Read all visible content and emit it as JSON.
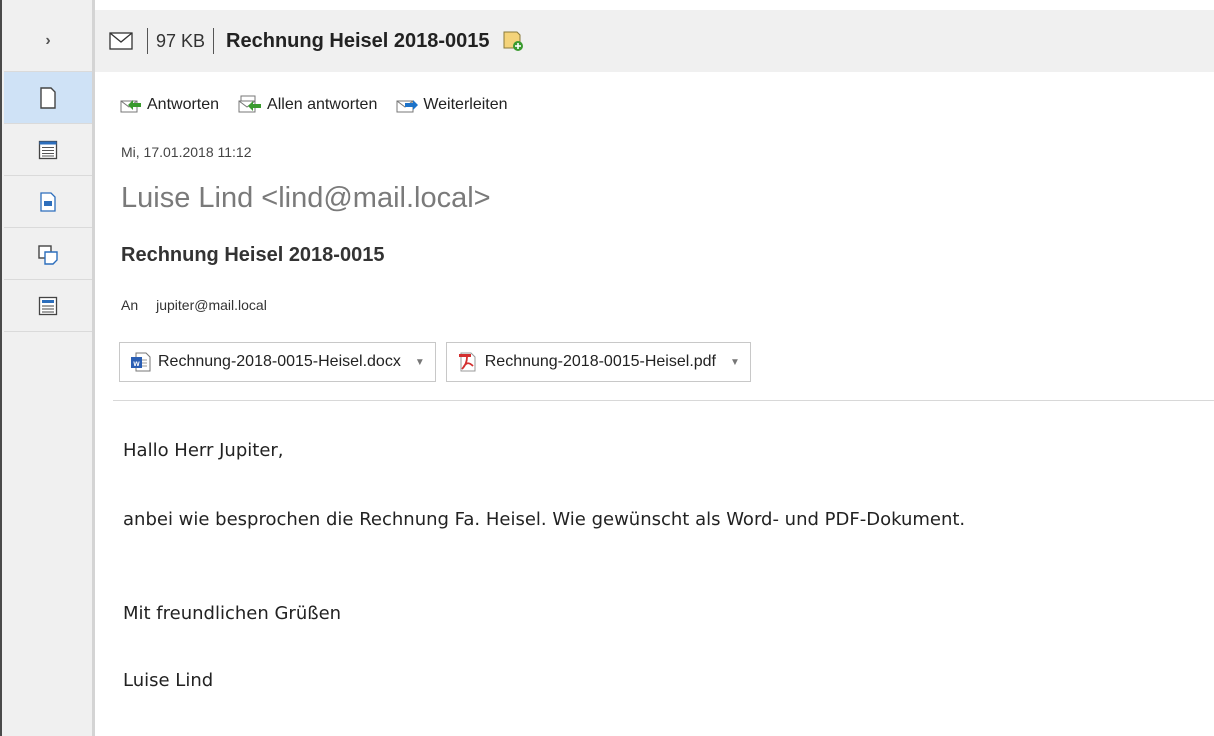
{
  "header": {
    "size": "97 KB",
    "subject": "Rechnung Heisel 2018-0015"
  },
  "rail": {
    "items": [
      "expand",
      "message-view",
      "table-view",
      "text-view",
      "notes-view",
      "details-view"
    ]
  },
  "actions": {
    "reply": "Antworten",
    "reply_all": "Allen antworten",
    "forward": "Weiterleiten"
  },
  "message": {
    "date": "Mi, 17.01.2018 11:12",
    "sender": "Luise Lind <lind@mail.local>",
    "subject": "Rechnung Heisel 2018-0015",
    "to_label": "An",
    "to": "jupiter@mail.local"
  },
  "attachments": [
    {
      "name": "Rechnung-2018-0015-Heisel.docx",
      "icon": "word-icon"
    },
    {
      "name": "Rechnung-2018-0015-Heisel.pdf",
      "icon": "pdf-icon"
    }
  ],
  "body": {
    "greeting": "Hallo Herr Jupiter,",
    "line1": "anbei wie besprochen die Rechnung Fa. Heisel. Wie gewünscht als Word- und PDF-Dokument.",
    "closing": "Mit freundlichen Grüßen",
    "signature": "Luise Lind"
  },
  "colors": {
    "active_rail": "#cfe2f6",
    "pdf_red": "#d32f2f",
    "word_blue": "#2b5fb4",
    "reply_green": "#3a9a2f",
    "forward_blue": "#1e73c9"
  }
}
